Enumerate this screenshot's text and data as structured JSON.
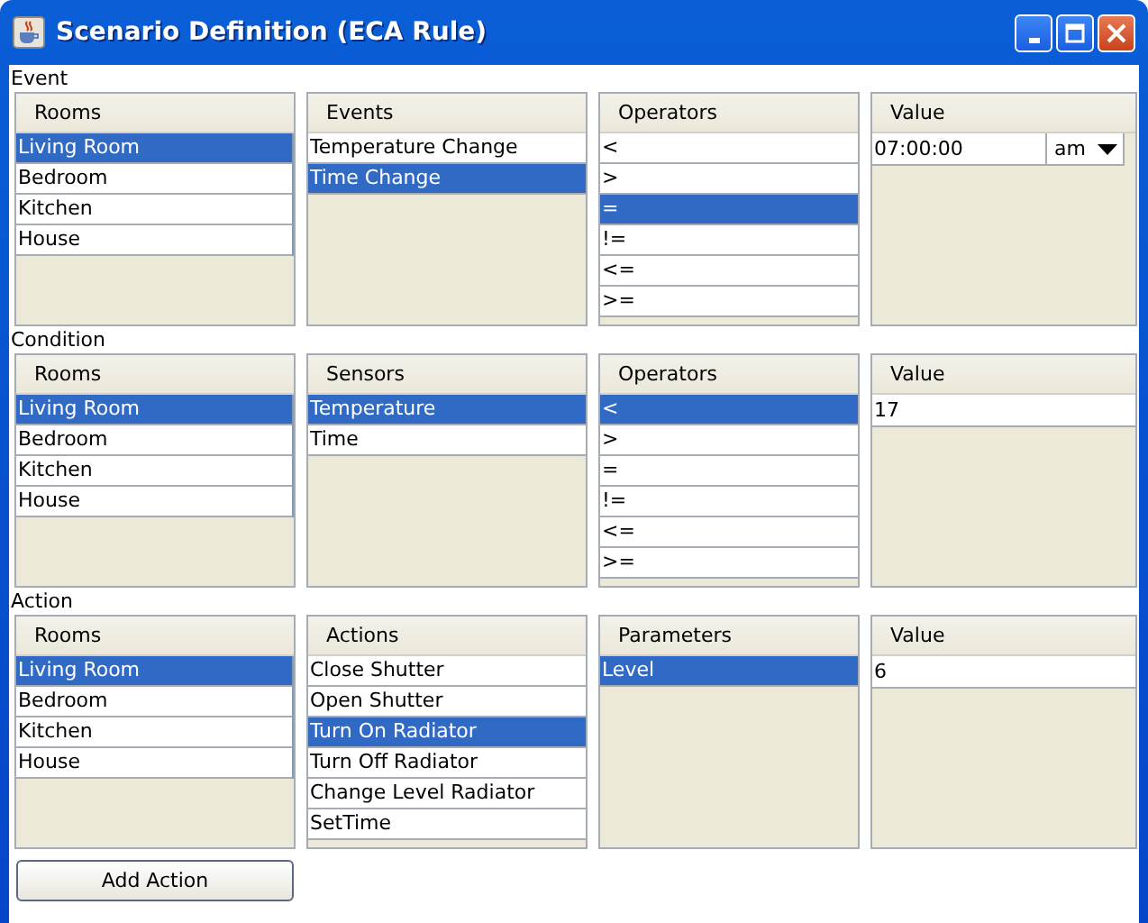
{
  "window": {
    "title": "Scenario Definition (ECA Rule)"
  },
  "sections": [
    {
      "label": "Event",
      "panels": [
        {
          "kind": "list",
          "header": "Rooms",
          "items": [
            {
              "label": "Living Room",
              "selected": true
            },
            {
              "label": "Bedroom",
              "selected": false
            },
            {
              "label": "Kitchen",
              "selected": false
            },
            {
              "label": "House",
              "selected": false
            }
          ]
        },
        {
          "kind": "list",
          "header": "Events",
          "items": [
            {
              "label": "Temperature Change",
              "selected": false
            },
            {
              "label": "Time Change",
              "selected": true
            }
          ]
        },
        {
          "kind": "list",
          "header": "Operators",
          "items": [
            {
              "label": "<",
              "selected": false
            },
            {
              "label": ">",
              "selected": false
            },
            {
              "label": "=",
              "selected": true
            },
            {
              "label": "!=",
              "selected": false
            },
            {
              "label": "<=",
              "selected": false
            },
            {
              "label": ">=",
              "selected": false
            }
          ]
        },
        {
          "kind": "time",
          "header": "Value",
          "value": "07:00:00",
          "period": "am"
        }
      ]
    },
    {
      "label": "Condition",
      "panels": [
        {
          "kind": "list",
          "header": "Rooms",
          "items": [
            {
              "label": "Living Room",
              "selected": true
            },
            {
              "label": "Bedroom",
              "selected": false
            },
            {
              "label": "Kitchen",
              "selected": false
            },
            {
              "label": "House",
              "selected": false
            }
          ]
        },
        {
          "kind": "list",
          "header": "Sensors",
          "items": [
            {
              "label": "Temperature",
              "selected": true
            },
            {
              "label": "Time",
              "selected": false
            }
          ]
        },
        {
          "kind": "list",
          "header": "Operators",
          "items": [
            {
              "label": "<",
              "selected": true
            },
            {
              "label": ">",
              "selected": false
            },
            {
              "label": "=",
              "selected": false
            },
            {
              "label": "!=",
              "selected": false
            },
            {
              "label": "<=",
              "selected": false
            },
            {
              "label": ">=",
              "selected": false
            }
          ]
        },
        {
          "kind": "text",
          "header": "Value",
          "value": "17"
        }
      ]
    },
    {
      "label": "Action",
      "panels": [
        {
          "kind": "list",
          "header": "Rooms",
          "items": [
            {
              "label": "Living Room",
              "selected": true
            },
            {
              "label": "Bedroom",
              "selected": false
            },
            {
              "label": "Kitchen",
              "selected": false
            },
            {
              "label": "House",
              "selected": false
            }
          ]
        },
        {
          "kind": "list",
          "header": "Actions",
          "items": [
            {
              "label": "Close Shutter",
              "selected": false
            },
            {
              "label": "Open Shutter",
              "selected": false
            },
            {
              "label": "Turn On Radiator",
              "selected": true
            },
            {
              "label": "Turn Off Radiator",
              "selected": false
            },
            {
              "label": "Change Level Radiator",
              "selected": false
            },
            {
              "label": "SetTime",
              "selected": false
            }
          ]
        },
        {
          "kind": "list",
          "header": "Parameters",
          "items": [
            {
              "label": "Level",
              "selected": true
            }
          ]
        },
        {
          "kind": "text",
          "header": "Value",
          "value": "6"
        }
      ]
    }
  ],
  "button": "Add Action"
}
